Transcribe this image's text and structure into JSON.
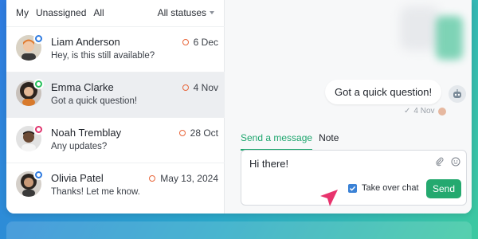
{
  "filters": {
    "tabs": [
      "My",
      "Unassigned",
      "All"
    ],
    "status_label": "All statuses"
  },
  "conversations": [
    {
      "name": "Liam Anderson",
      "message": "Hey, is this still available?",
      "date": "6 Dec",
      "channel": "messenger",
      "channel_color": "#2f7be0",
      "avatar_bg": "#d9d2c4",
      "hair": "#e07a2e",
      "shirt": "#3a3a3a"
    },
    {
      "name": "Emma Clarke",
      "message": "Got a quick question!",
      "date": "4 Nov",
      "channel": "whatsapp",
      "channel_color": "#25c05a",
      "avatar_bg": "#c8c1bb",
      "hair": "#2c241e",
      "shirt": "#d87a2c"
    },
    {
      "name": "Noah Tremblay",
      "message": "Any updates?",
      "date": "28 Oct",
      "channel": "instagram",
      "channel_color": "#e0336d",
      "avatar_bg": "#e2e2e2",
      "hair": "#1f1a17",
      "shirt": "#e8e8e8"
    },
    {
      "name": "Olivia Patel",
      "message": "Thanks! Let me know.",
      "date": "May 13, 2024",
      "channel": "messenger",
      "channel_color": "#2f7be0",
      "avatar_bg": "#d4cfc9",
      "hair": "#2a2420",
      "shirt": "#3a3a3a"
    }
  ],
  "chat": {
    "bubble_text": "Got a quick question!",
    "timestamp": "4 Nov",
    "composer_tabs": [
      "Send a message",
      "Note"
    ],
    "composer_text": "Hi there!",
    "takeover_label": "Take over chat",
    "send_label": "Send"
  },
  "colors": {
    "accent": "#24a96f",
    "status_ring": "#e8663a",
    "checkbox": "#3b82d6",
    "cursor": "#e8336d"
  }
}
